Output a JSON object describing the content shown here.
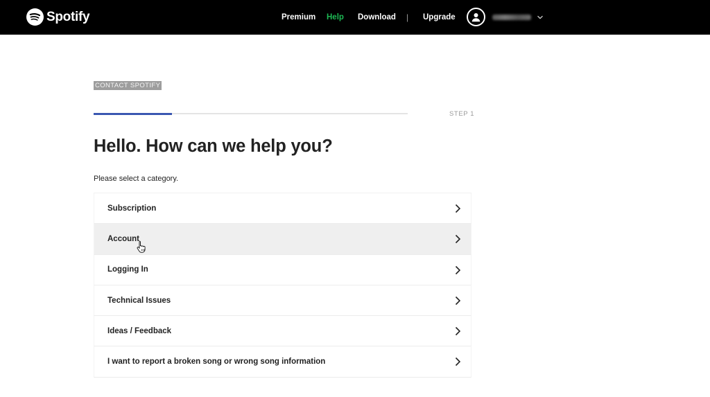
{
  "header": {
    "logo_text": "Spotify",
    "nav": {
      "premium": "Premium",
      "help": "Help",
      "download": "Download",
      "separator": "|",
      "upgrade": "Upgrade"
    },
    "user_icon": "user-icon",
    "caret_icon": "chevron-down-icon"
  },
  "colors": {
    "brand_green": "#1db954",
    "progress_blue": "#3b57b1"
  },
  "page": {
    "eyebrow": "CONTACT SPOTIFY",
    "step_label": "STEP 1",
    "progress_fraction": 0.25,
    "heading": "Hello. How can we help you?",
    "prompt": "Please select a category."
  },
  "categories": [
    {
      "label": "Subscription"
    },
    {
      "label": "Account"
    },
    {
      "label": "Logging In"
    },
    {
      "label": "Technical Issues"
    },
    {
      "label": "Ideas / Feedback"
    },
    {
      "label": "I want to report a broken song or wrong song information"
    }
  ]
}
